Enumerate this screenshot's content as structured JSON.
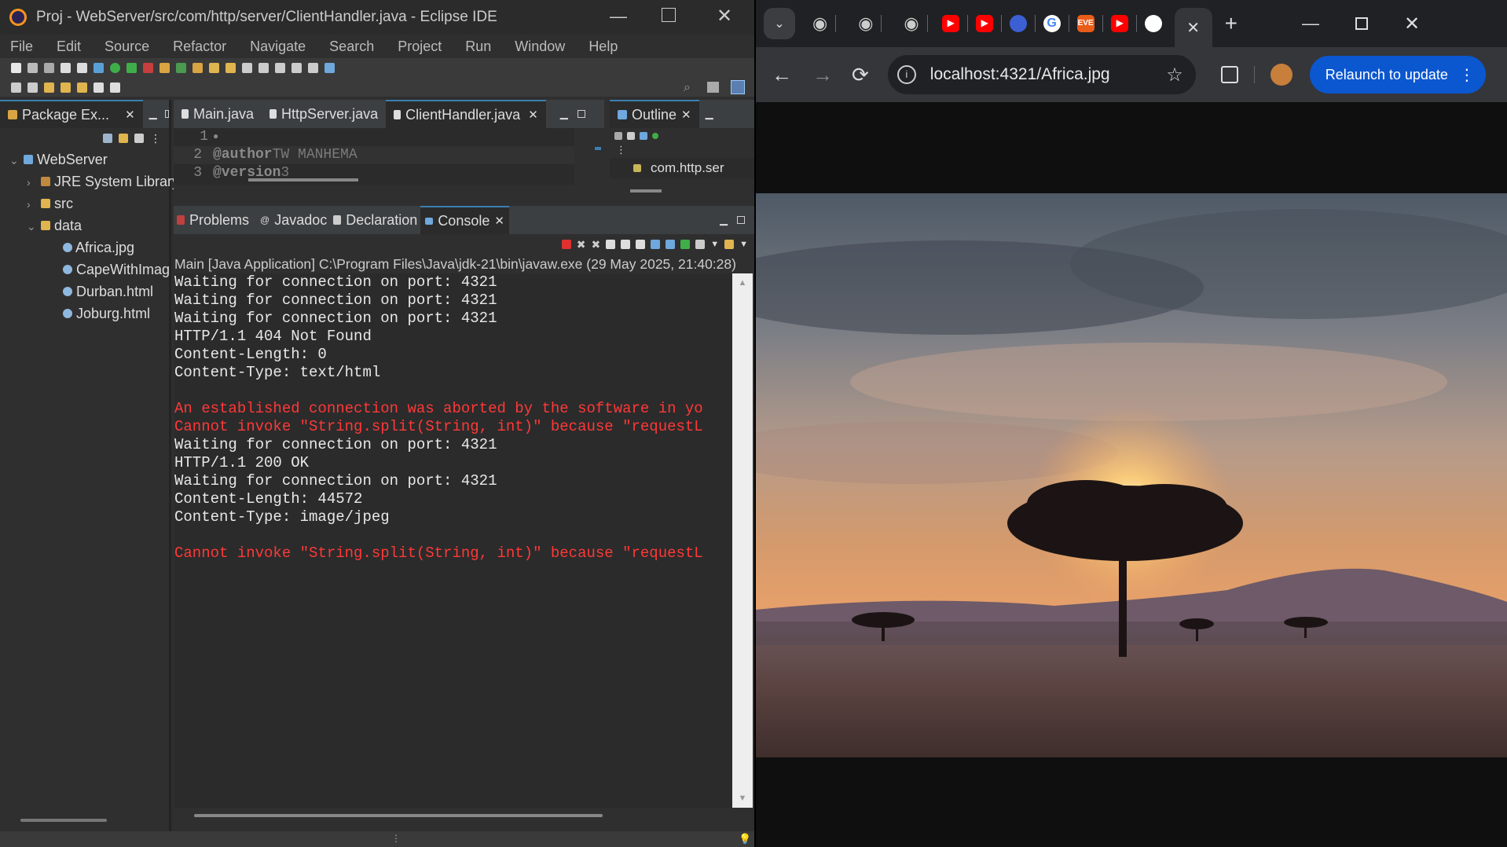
{
  "eclipse": {
    "title": "Proj - WebServer/src/com/http/server/ClientHandler.java - Eclipse IDE",
    "menu": [
      "File",
      "Edit",
      "Source",
      "Refactor",
      "Navigate",
      "Search",
      "Project",
      "Run",
      "Window",
      "Help"
    ],
    "package_explorer": {
      "tab": "Package Ex...",
      "project": "WebServer",
      "items": [
        "JRE System Library",
        "src",
        "data"
      ],
      "files": [
        "Africa.jpg",
        "CapeWithImag",
        "Durban.html",
        "Joburg.html"
      ]
    },
    "editor": {
      "tabs": [
        "Main.java",
        "HttpServer.java",
        "ClientHandler.java"
      ],
      "lines": [
        {
          "n": "1",
          "text": ""
        },
        {
          "n": "2",
          "tag": "@author",
          "rest": " TW MANHEMA"
        },
        {
          "n": "3",
          "tag": "@version",
          "rest": " 3"
        }
      ]
    },
    "outline": {
      "tab": "Outline",
      "item": "com.http.ser"
    },
    "bottom_tabs": [
      "Problems",
      "Javadoc",
      "Declaration",
      "Console"
    ],
    "console": {
      "header": "Main [Java Application] C:\\Program Files\\Java\\jdk-21\\bin\\javaw.exe  (29 May 2025, 21:40:28)",
      "lines": [
        {
          "t": "Waiting for connection on port: 4321",
          "err": false
        },
        {
          "t": "Waiting for connection on port: 4321",
          "err": false
        },
        {
          "t": "Waiting for connection on port: 4321",
          "err": false
        },
        {
          "t": "HTTP/1.1 404 Not Found",
          "err": false
        },
        {
          "t": "Content-Length: 0",
          "err": false
        },
        {
          "t": "Content-Type: text/html",
          "err": false
        },
        {
          "t": "",
          "err": false
        },
        {
          "t": "An established connection was aborted by the software in yo",
          "err": true
        },
        {
          "t": "Cannot invoke \"String.split(String, int)\" because \"requestL",
          "err": true
        },
        {
          "t": "Waiting for connection on port: 4321",
          "err": false
        },
        {
          "t": "HTTP/1.1 200 OK",
          "err": false
        },
        {
          "t": "Waiting for connection on port: 4321",
          "err": false
        },
        {
          "t": "Content-Length: 44572",
          "err": false
        },
        {
          "t": "Content-Type: image/jpeg",
          "err": false
        },
        {
          "t": "",
          "err": false
        },
        {
          "t": "Cannot invoke \"String.split(String, int)\" because \"requestL",
          "err": true
        }
      ]
    }
  },
  "browser": {
    "url": "localhost:4321/Africa.jpg",
    "relaunch": "Relaunch to update",
    "tab_icons": [
      "globe-icon",
      "globe-icon",
      "globe-icon",
      "youtube-icon",
      "youtube-icon",
      "bird-icon",
      "google-icon",
      "eve-icon",
      "youtube-icon",
      "github-icon"
    ],
    "eve_label": "EVE",
    "google_label": "G"
  },
  "colors": {
    "accent": "#3c7fb1",
    "error": "#ff3838",
    "chrome_blue": "#0b57d0"
  }
}
